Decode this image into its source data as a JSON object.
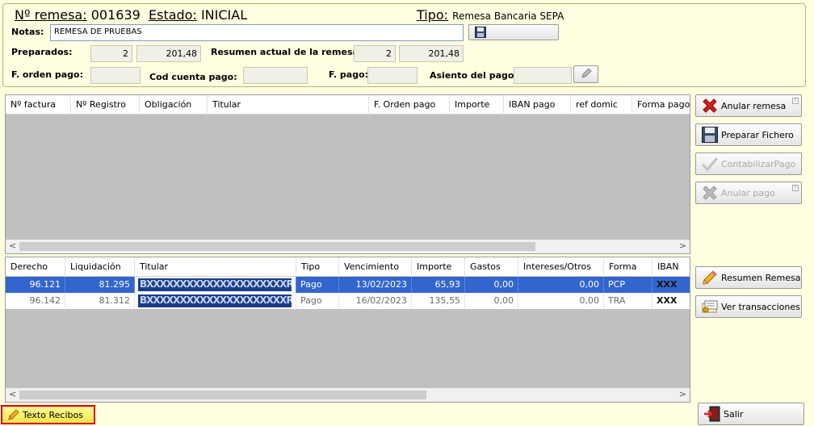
{
  "header": {
    "remesa_label": "Nº remesa:",
    "remesa_value": "001639",
    "estado_label": "Estado:",
    "estado_value": "INICIAL",
    "tipo_label": "Tipo:",
    "tipo_value": "Remesa Bancaria SEPA",
    "notas_label": "Notas:",
    "notas_value": "REMESA DE PRUEBAS",
    "salvar_notas": "Salvar Notas",
    "preparados_label": "Preparados:",
    "preparados_count": "2",
    "preparados_amount": "201,48",
    "resumen_label": "Resumen actual de la remesa:",
    "resumen_count": "2",
    "resumen_amount": "201,48",
    "forden_label": "F. orden pago:",
    "forden_value": "",
    "codcuenta_label": "Cod cuenta pago:",
    "codcuenta_value": "",
    "fpago_label": "F. pago:",
    "fpago_value": "",
    "asiento_label": "Asiento del pago:",
    "asiento_value": ""
  },
  "top_grid": {
    "columns": [
      "Nº factura",
      "Nº Registro",
      "Obligación",
      "Titular",
      "F. Orden pago",
      "Importe",
      "IBAN pago",
      "ref domic",
      "Forma pago"
    ]
  },
  "bottom_grid": {
    "columns": [
      "Derecho",
      "Liquidación",
      "Titular",
      "Tipo",
      "Vencimiento",
      "Importe",
      "Gastos",
      "Intereses/Otros",
      "Forma",
      "IBAN"
    ],
    "rows": [
      {
        "derecho": "96.121",
        "liquidacion": "81.295",
        "titular": "BXXXXXXXXXXXXXXXXXXXXXRO",
        "tipo": "Pago",
        "vencimiento": "13/02/2023",
        "importe": "65,93",
        "gastos": "0,00",
        "intereses": "0,00",
        "forma": "PCP",
        "iban": "XXX"
      },
      {
        "derecho": "96.142",
        "liquidacion": "81.312",
        "titular": "BXXXXXXXXXXXXXXXXXXXXXRO",
        "tipo": "Pago",
        "vencimiento": "16/02/2023",
        "importe": "135,55",
        "gastos": "0,00",
        "intereses": "0,00",
        "forma": "TRA",
        "iban": "XXX"
      }
    ]
  },
  "actions": {
    "anular_remesa": "Anular remesa",
    "preparar_fichero": "Preparar Fichero",
    "contabilizar_pago": "ContabilizarPago",
    "anular_pago": "Anular pago",
    "resumen_remesa": "Resumen Remesa",
    "ver_transacciones": "Ver transacciones",
    "salir": "Salir",
    "texto_recibos": "Texto Recibos"
  },
  "colors": {
    "background": "#ffffe1",
    "selection": "#3366cc",
    "highlight_border": "#e00000"
  },
  "icons": [
    "red-x-icon",
    "floppy-disk-icon",
    "checkmark-icon",
    "gray-x-icon",
    "pencil-icon",
    "receipt-icon",
    "exit-door-icon"
  ]
}
